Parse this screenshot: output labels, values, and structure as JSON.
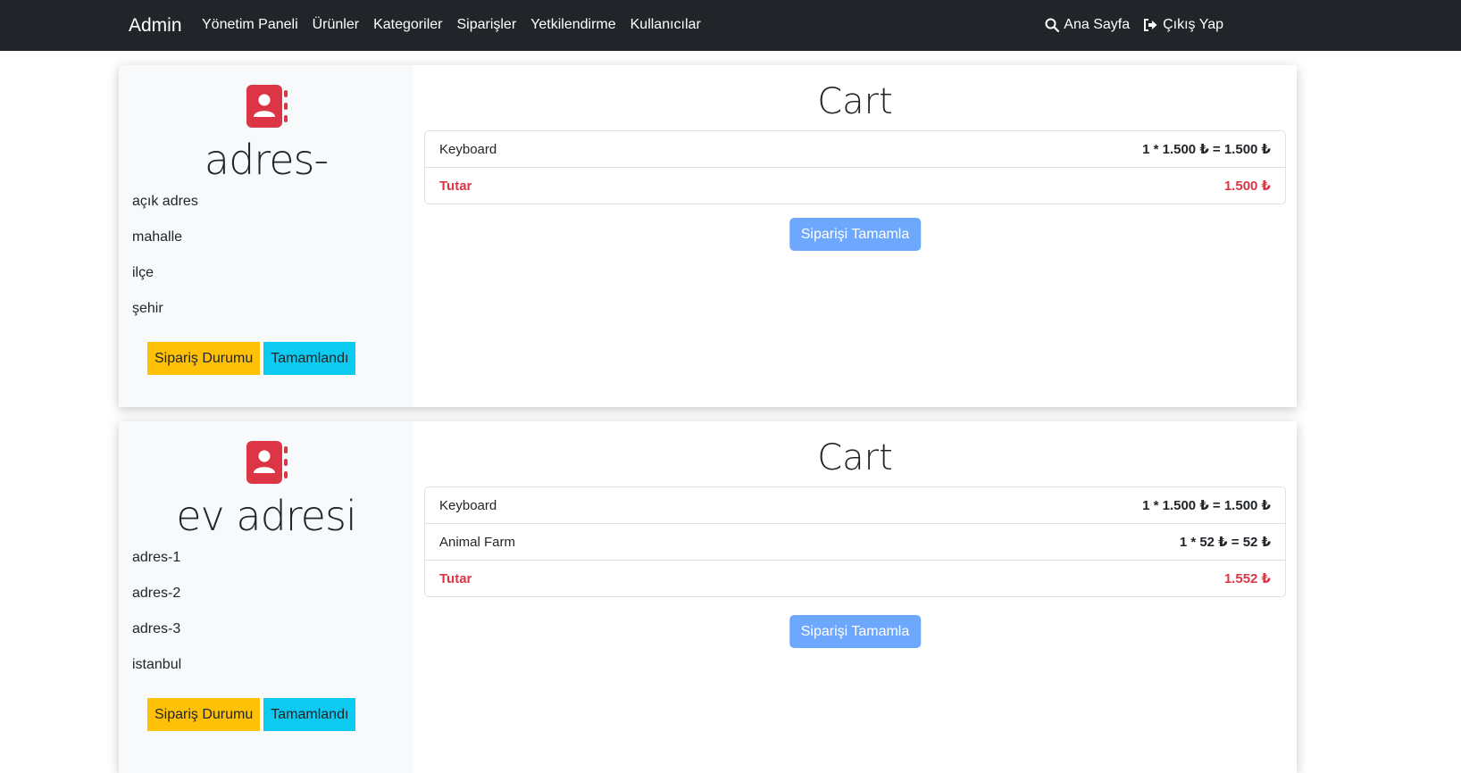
{
  "navbar": {
    "brand": "Admin",
    "links": [
      "Yönetim Paneli",
      "Ürünler",
      "Kategoriler",
      "Siparişler",
      "Yetkilendirme",
      "Kullanıcılar"
    ],
    "home_label": "Ana Sayfa",
    "logout_label": "Çıkış Yap"
  },
  "orders": [
    {
      "address_title": "adres-",
      "address_lines": [
        "açık adres",
        "mahalle",
        "ilçe",
        "şehir"
      ],
      "status_button": "Sipariş Durumu",
      "status_value": "Tamamlandı",
      "cart_title": "Cart",
      "items": [
        {
          "name": "Keyboard",
          "price": "1 * 1.500 ₺ = 1.500 ₺"
        }
      ],
      "total_label": "Tutar",
      "total_value": "1.500 ₺",
      "complete_button": "Siparişi Tamamla"
    },
    {
      "address_title": "ev adresi",
      "address_lines": [
        "adres-1",
        "adres-2",
        "adres-3",
        "istanbul"
      ],
      "status_button": "Sipariş Durumu",
      "status_value": "Tamamlandı",
      "cart_title": "Cart",
      "items": [
        {
          "name": "Keyboard",
          "price": "1 * 1.500 ₺ = 1.500 ₺"
        },
        {
          "name": "Animal Farm",
          "price": "1 * 52 ₺ = 52 ₺"
        }
      ],
      "total_label": "Tutar",
      "total_value": "1.552 ₺",
      "complete_button": "Siparişi Tamamla"
    }
  ],
  "colors": {
    "navbar_bg": "#212529",
    "accent_red": "#dc3545",
    "status_yellow": "#ffc107",
    "status_cyan": "#0dcaf0",
    "button_blue": "#6ea8fe"
  },
  "icons": [
    "search-icon",
    "sign-out-icon",
    "address-book-icon"
  ]
}
